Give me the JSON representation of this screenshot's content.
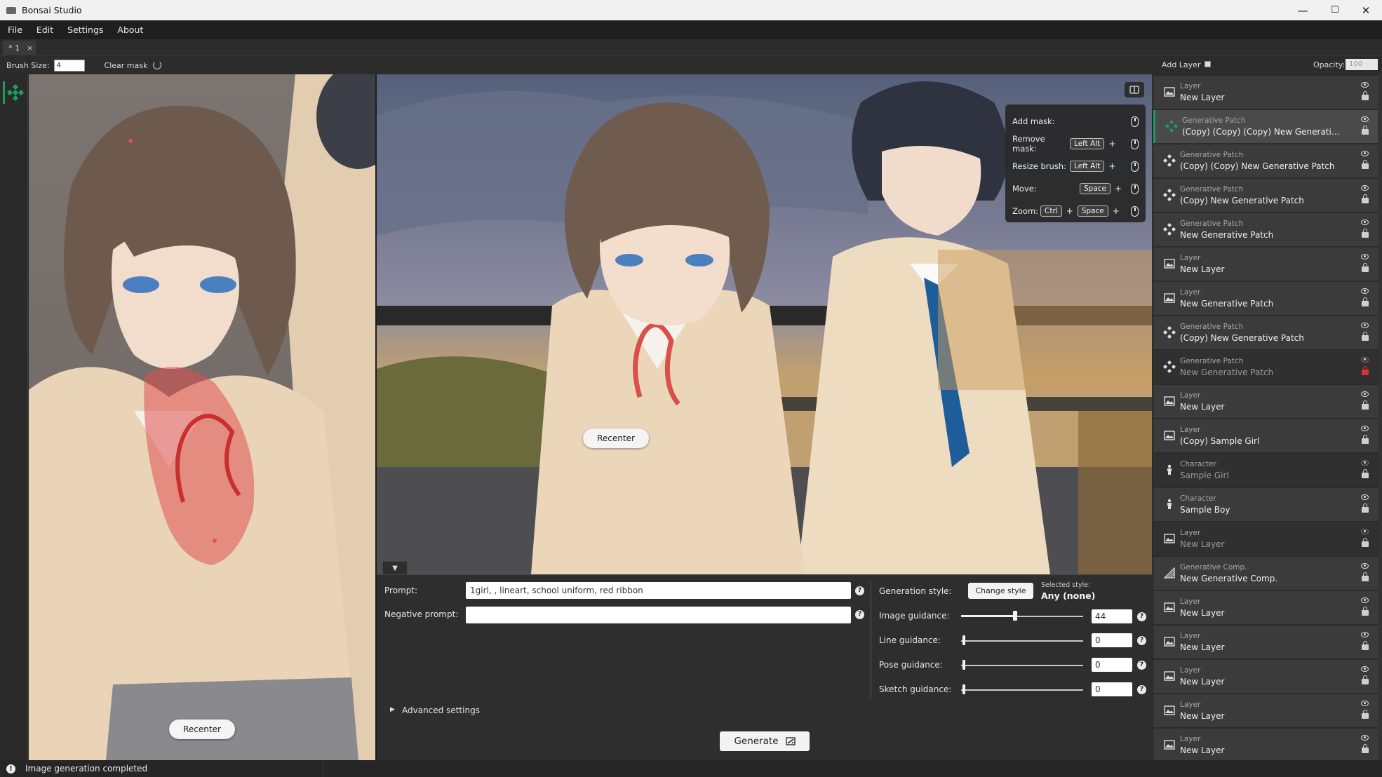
{
  "window": {
    "title": "Bonsai Studio",
    "minimize": "—",
    "maximize": "☐",
    "close": "✕"
  },
  "menu": [
    "File",
    "Edit",
    "Settings",
    "About"
  ],
  "document_tab": {
    "label": "* 1",
    "close": "×"
  },
  "toolbar": {
    "brush_size_label": "Brush Size:",
    "brush_size_value": "4",
    "clear_mask_label": "Clear mask"
  },
  "canvas": {
    "recenter_label": "Recenter"
  },
  "shortcuts": [
    {
      "label": "Add mask:",
      "keys": []
    },
    {
      "label": "Remove mask:",
      "keys": [
        "Left Alt"
      ]
    },
    {
      "label": "Resize brush:",
      "keys": [
        "Left Alt"
      ]
    },
    {
      "label": "Move:",
      "keys": [
        "Space"
      ]
    },
    {
      "label": "Zoom:",
      "keys": [
        "Ctrl",
        "Space"
      ]
    }
  ],
  "generation": {
    "prompt_label": "Prompt:",
    "prompt_value": "1girl,                  , lineart, school uniform, red ribbon",
    "negative_prompt_label": "Negative prompt:",
    "negative_prompt_value": "",
    "advanced_settings_label": "Advanced settings",
    "generate_label": "Generate",
    "generation_style_label": "Generation style:",
    "change_style_label": "Change style",
    "selected_style_label": "Selected style:",
    "selected_style_value": "Any (none)",
    "image_guidance_label": "Image guidance:",
    "image_guidance_value": "44",
    "line_guidance_label": "Line guidance:",
    "line_guidance_value": "0",
    "pose_guidance_label": "Pose guidance:",
    "pose_guidance_value": "0",
    "sketch_guidance_label": "Sketch guidance:",
    "sketch_guidance_value": "0",
    "help_glyph": "?"
  },
  "status": {
    "icon": "!",
    "text": "Image generation completed"
  },
  "layers_panel": {
    "add_layer_label": "Add Layer",
    "opacity_label": "Opacity:",
    "opacity_value": "100",
    "layers": [
      {
        "type": "Layer",
        "name": "New Layer",
        "icon": "image-icon",
        "state": "normal"
      },
      {
        "type": "Generative Patch",
        "name": "(Copy) (Copy) (Copy) New Generative Patch",
        "icon": "generative-patch-icon",
        "state": "selected"
      },
      {
        "type": "Generative Patch",
        "name": "(Copy) (Copy) New Generative Patch",
        "icon": "generative-patch-icon",
        "state": "normal"
      },
      {
        "type": "Generative Patch",
        "name": "(Copy) New Generative Patch",
        "icon": "generative-patch-icon",
        "state": "normal"
      },
      {
        "type": "Generative Patch",
        "name": "New Generative Patch",
        "icon": "generative-patch-icon",
        "state": "normal"
      },
      {
        "type": "Layer",
        "name": "New Layer",
        "icon": "image-icon",
        "state": "normal"
      },
      {
        "type": "Layer",
        "name": "New Generative Patch",
        "icon": "image-icon",
        "state": "normal"
      },
      {
        "type": "Generative Patch",
        "name": "(Copy) New Generative Patch",
        "icon": "generative-patch-icon",
        "state": "normal"
      },
      {
        "type": "Generative Patch",
        "name": "New Generative Patch",
        "icon": "generative-patch-icon",
        "state": "hidden-locked"
      },
      {
        "type": "Layer",
        "name": "New Layer",
        "icon": "image-icon",
        "state": "normal"
      },
      {
        "type": "Layer",
        "name": "(Copy) Sample Girl",
        "icon": "image-icon",
        "state": "normal"
      },
      {
        "type": "Character",
        "name": "Sample Girl",
        "icon": "character-icon",
        "state": "hidden"
      },
      {
        "type": "Character",
        "name": "Sample Boy",
        "icon": "character-icon",
        "state": "normal"
      },
      {
        "type": "Layer",
        "name": "New Layer",
        "icon": "image-icon",
        "state": "hidden"
      },
      {
        "type": "Generative Comp.",
        "name": "New Generative Comp.",
        "icon": "generative-comp-icon",
        "state": "normal"
      },
      {
        "type": "Layer",
        "name": "New Layer",
        "icon": "image-icon",
        "state": "normal"
      },
      {
        "type": "Layer",
        "name": "New Layer",
        "icon": "image-icon",
        "state": "normal"
      },
      {
        "type": "Layer",
        "name": "New Layer",
        "icon": "image-icon",
        "state": "normal"
      },
      {
        "type": "Layer",
        "name": "New Layer",
        "icon": "image-icon",
        "state": "normal"
      },
      {
        "type": "Layer",
        "name": "New Layer",
        "icon": "image-icon",
        "state": "normal"
      }
    ]
  },
  "colors": {
    "accent": "#1e9e5c",
    "mask": "#e05050",
    "lock_active": "#e03030"
  }
}
